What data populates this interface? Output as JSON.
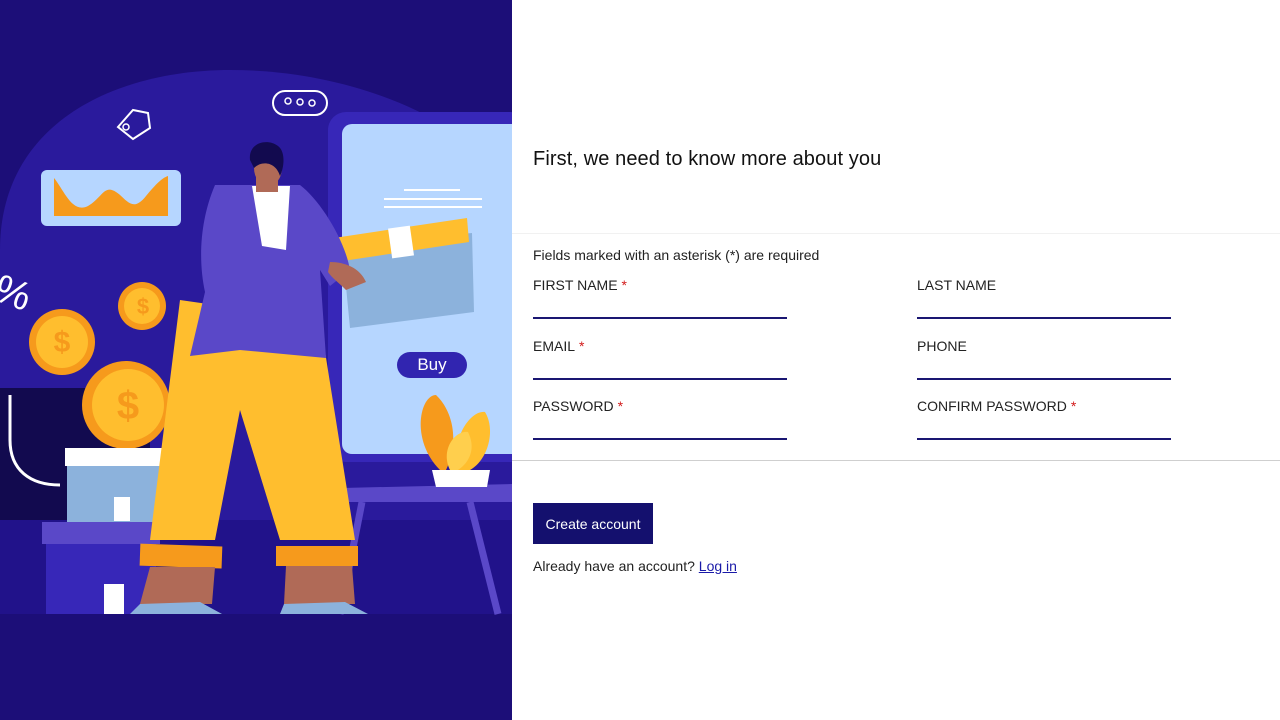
{
  "illustration": {
    "buy_label": "Buy"
  },
  "form": {
    "title": "First, we need to know more about you",
    "required_note": "Fields marked with an asterisk (*) are required",
    "required_mark": "*",
    "fields": [
      {
        "label": "FIRST NAME",
        "required": true,
        "value": ""
      },
      {
        "label": "LAST NAME",
        "required": false,
        "value": ""
      },
      {
        "label": "EMAIL",
        "required": true,
        "value": ""
      },
      {
        "label": "PHONE",
        "required": false,
        "value": ""
      },
      {
        "label": "PASSWORD",
        "required": true,
        "value": ""
      },
      {
        "label": "CONFIRM PASSWORD",
        "required": true,
        "value": ""
      }
    ],
    "submit_label": "Create account",
    "login_prompt": "Already have an account?",
    "login_link": "Log in"
  },
  "colors": {
    "left_panel_bg": "#1c0e78",
    "accent": "#14106e",
    "field_underline": "#1a1672",
    "required_star": "#d21a1a",
    "link": "#1a1aa8"
  }
}
